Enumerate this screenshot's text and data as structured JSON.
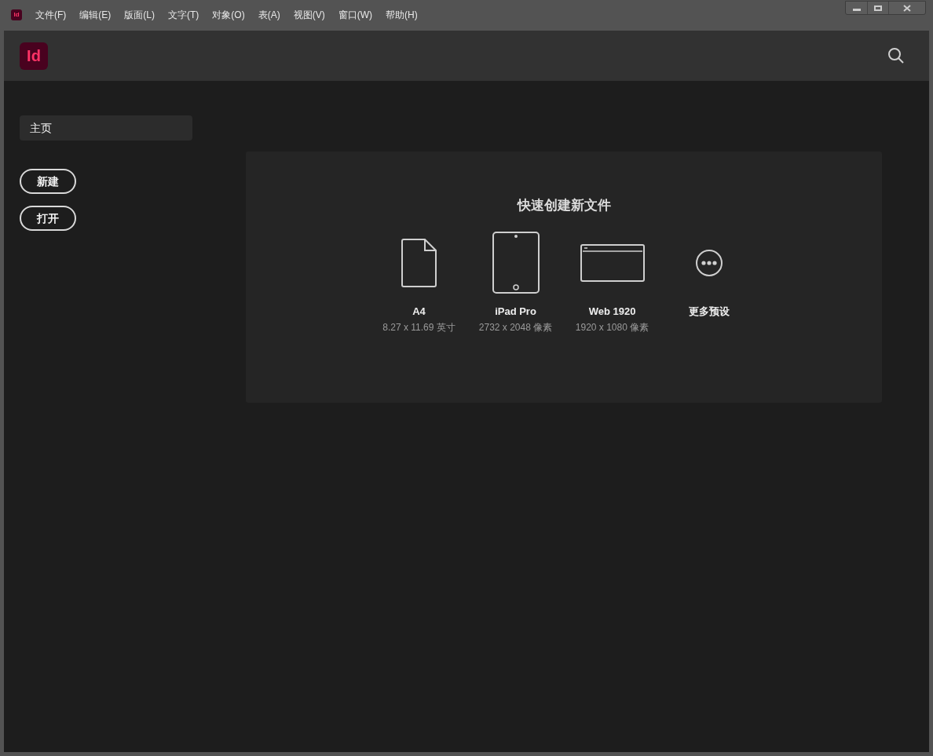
{
  "menu_bar": {
    "app_icon": "Id",
    "items": [
      "文件(F)",
      "编辑(E)",
      "版面(L)",
      "文字(T)",
      "对象(O)",
      "表(A)",
      "视图(V)",
      "窗口(W)",
      "帮助(H)"
    ]
  },
  "header": {
    "logo": "Id"
  },
  "sidebar": {
    "items": [
      {
        "label": "主页",
        "selected": true
      }
    ],
    "buttons": [
      "新建",
      "打开"
    ]
  },
  "quick_create": {
    "title": "快速创建新文件",
    "presets": [
      {
        "kind": "page",
        "name": "A4",
        "size": "8.27 x 11.69 英寸"
      },
      {
        "kind": "tablet",
        "name": "iPad Pro",
        "size": "2732 x 2048 像素"
      },
      {
        "kind": "web",
        "name": "Web 1920",
        "size": "1920 x 1080 像素"
      },
      {
        "kind": "more",
        "name": "更多预设"
      }
    ]
  }
}
